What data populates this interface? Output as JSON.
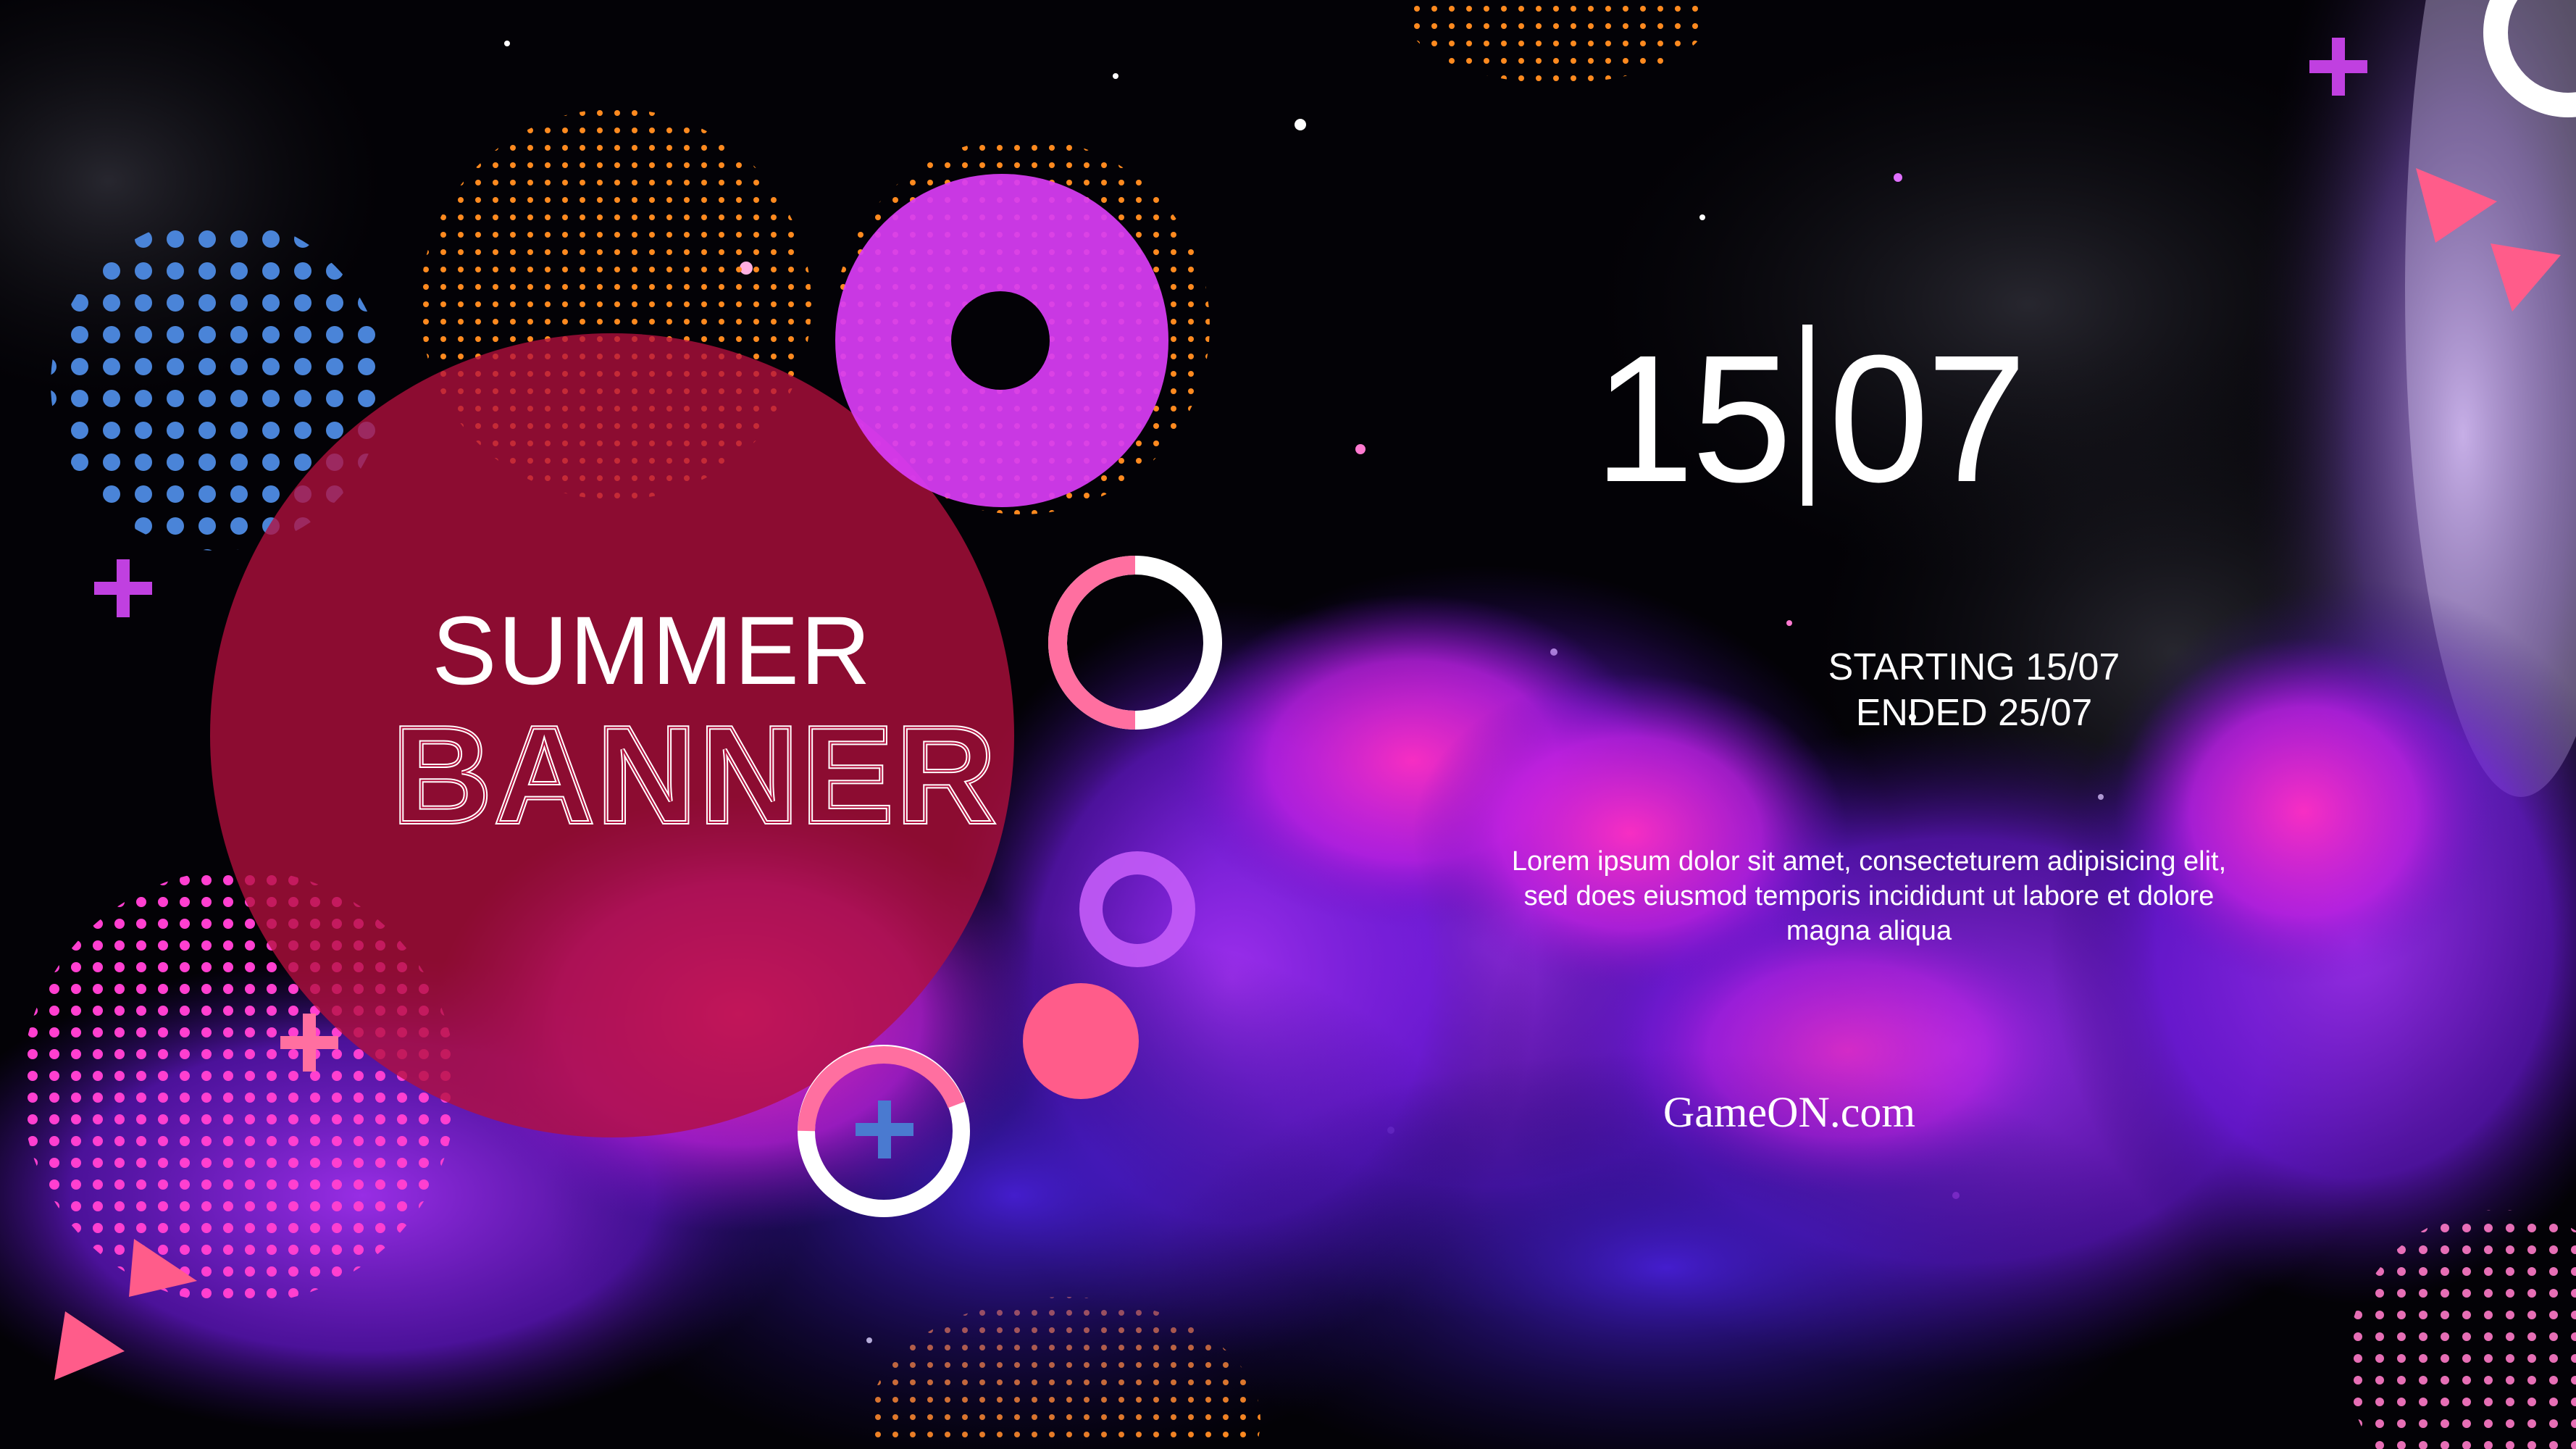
{
  "banner": {
    "title_top": "SUMMER",
    "title_bottom": "BANNER",
    "date_day": "15",
    "date_month": "07",
    "starting": "STARTING 15/07",
    "ended": "ENDED 25/07",
    "body_text": "Lorem ipsum dolor sit amet, consecteturem adipisicing elit, sed does eiusmod temporis incididunt ut labore et dolore magna aliqua",
    "website": "GameON.com"
  },
  "colors": {
    "background": "#030206",
    "circle_red": "#a0103a",
    "magenta": "#d83cf4",
    "pink": "#ff5c8a",
    "blue_dots": "#4a84d8",
    "orange_dots": "#ff8a1f",
    "pink_dots": "#ff3fd0",
    "violet_smoke": "#7a1fe0",
    "text": "#ffffff"
  },
  "icons": [
    "plus-icon",
    "triangle-icon",
    "ring-icon"
  ]
}
